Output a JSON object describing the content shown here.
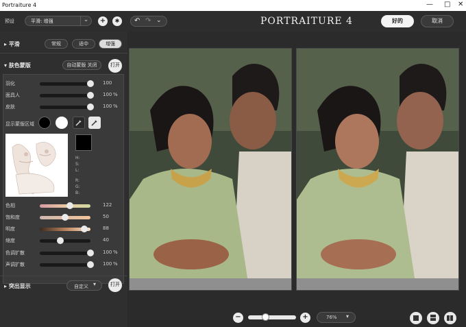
{
  "window": {
    "title": "Portraiture 4",
    "minimize": "—",
    "maximize": "□",
    "close": "✕"
  },
  "topbar": {
    "preset_label": "预设",
    "preset_value": "平滑: 增强",
    "app_name": "PORTRAITURE 4",
    "ok_label": "好的",
    "cancel_label": "取消",
    "add_icon": "+",
    "settings_icon": "✱",
    "undo_icon": "↶",
    "redo_icon": "↷",
    "chevron_icon": "⌄"
  },
  "smoothing": {
    "title": "平滑",
    "options": [
      "常规",
      "适中",
      "增强"
    ],
    "selected": "增强"
  },
  "skin_mask": {
    "title": "肤色蒙版",
    "auto_mask_label": "自动蒙版 关闭",
    "open_label": "打开",
    "sliders": [
      {
        "label": "羽化",
        "value": "100",
        "unit": ""
      },
      {
        "label": "面具人",
        "value": "100",
        "unit": "%"
      },
      {
        "label": "皮肤",
        "value": "100",
        "unit": "%"
      }
    ],
    "slider_levels": [
      1.0,
      1.0,
      1.0
    ],
    "show_mask_label": "显示蒙版区域",
    "hsl_labels": [
      "H:",
      "S:",
      "L:",
      "R:",
      "G:",
      "B:"
    ]
  },
  "adjust": {
    "sliders": [
      {
        "label": "色相",
        "value": "122",
        "unit": ""
      },
      {
        "label": "饱和度",
        "value": "50",
        "unit": ""
      },
      {
        "label": "明度",
        "value": "88",
        "unit": ""
      },
      {
        "label": "缩度",
        "value": "40",
        "unit": ""
      },
      {
        "label": "色调扩散",
        "value": "100",
        "unit": "%"
      },
      {
        "label": "声调扩散",
        "value": "100",
        "unit": "%"
      }
    ],
    "slider_levels": [
      0.6,
      0.5,
      0.88,
      0.4,
      1.0,
      1.0
    ]
  },
  "highlight": {
    "title": "突出显示",
    "preset_value": "自定义",
    "open_label": "打开"
  },
  "bottom": {
    "zoom_value": "76%",
    "zoom_out_icon": "−",
    "zoom_in_icon": "+",
    "zoom_level": 0.35
  }
}
